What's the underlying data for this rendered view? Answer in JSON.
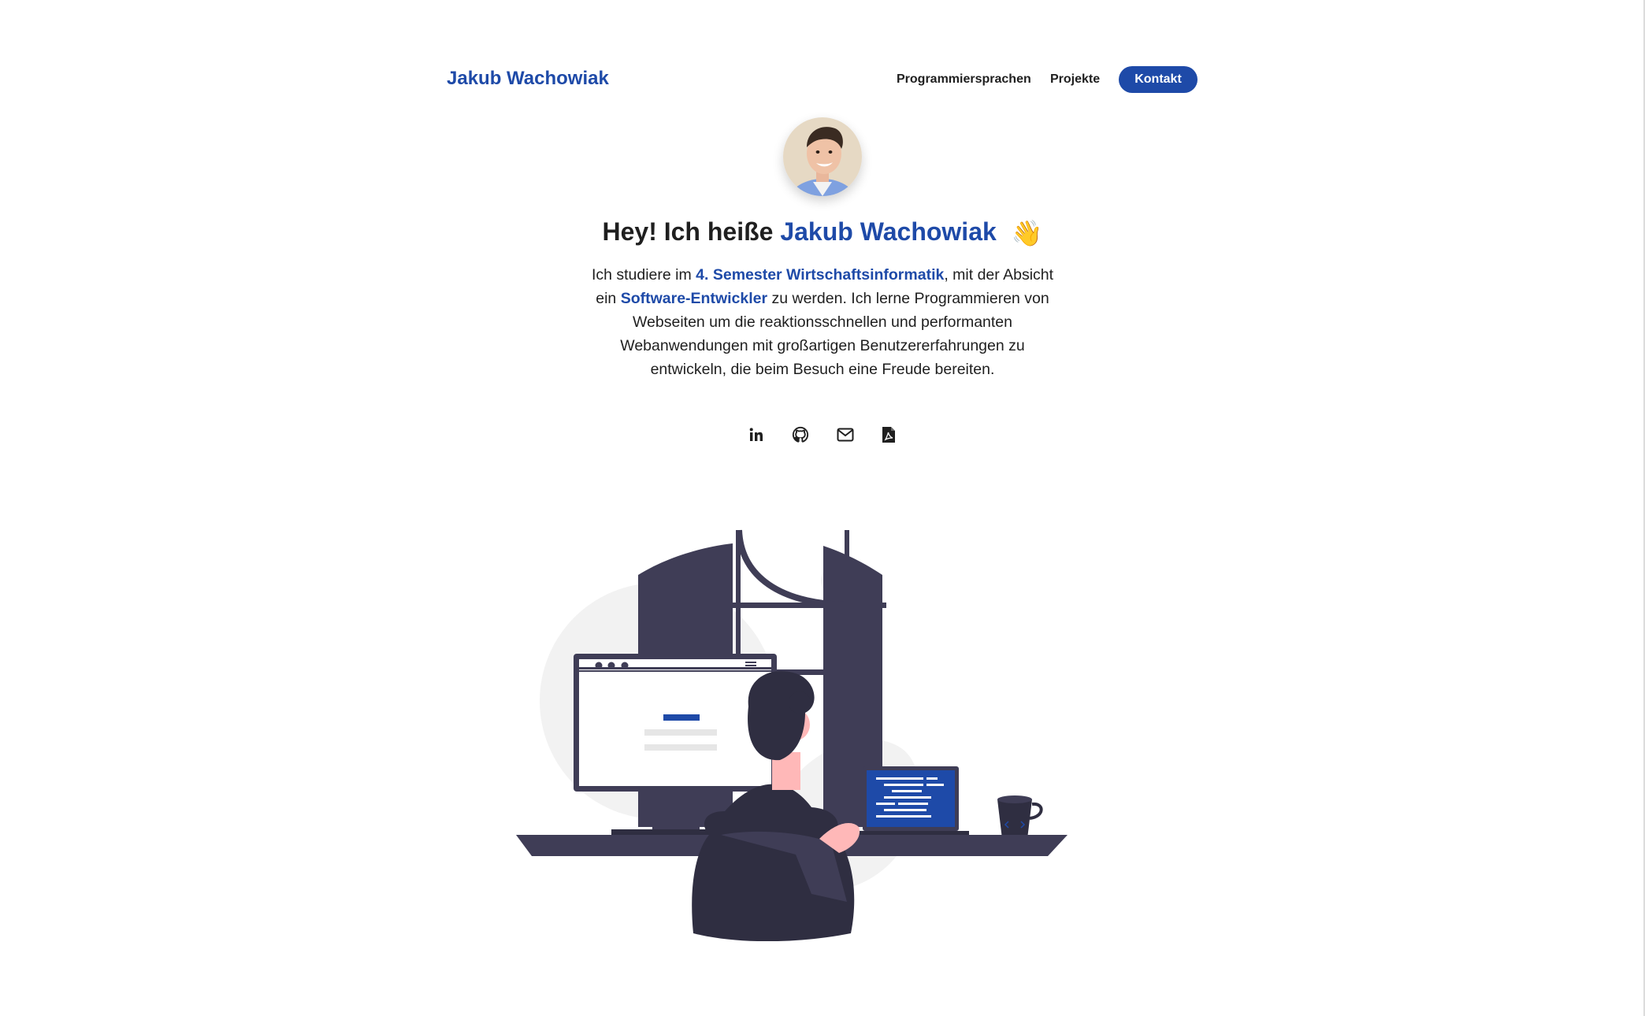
{
  "header": {
    "brand": "Jakub Wachowiak",
    "nav": {
      "languages": "Programmiersprachen",
      "projects": "Projekte",
      "contact": "Kontakt"
    }
  },
  "hero": {
    "title_prefix": "Hey! Ich heiße",
    "title_name": "Jakub Wachowiak",
    "title_emoji": "👋",
    "intro": [
      {
        "text": "Ich studiere im ",
        "highlight": false
      },
      {
        "text": "4. Semester Wirtschaftsinformatik",
        "highlight": true
      },
      {
        "text": ", mit der Absicht ein ",
        "highlight": false
      },
      {
        "text": "Software-Entwickler",
        "highlight": true
      },
      {
        "text": " zu werden. Ich lerne Programmieren von Webseiten um die reaktionsschnellen und performanten Webanwendungen mit großartigen Benutzererfahrungen zu entwickeln, die beim Besuch eine Freude bereiten.",
        "highlight": false
      }
    ]
  },
  "socials": [
    {
      "name": "linkedin-icon"
    },
    {
      "name": "github-icon"
    },
    {
      "name": "mail-icon"
    },
    {
      "name": "pdf-icon"
    }
  ],
  "colors": {
    "accent": "#1e4aa8",
    "text": "#1f1f1f",
    "dark": "#3f3d56",
    "light_gray": "#f2f2f2"
  }
}
